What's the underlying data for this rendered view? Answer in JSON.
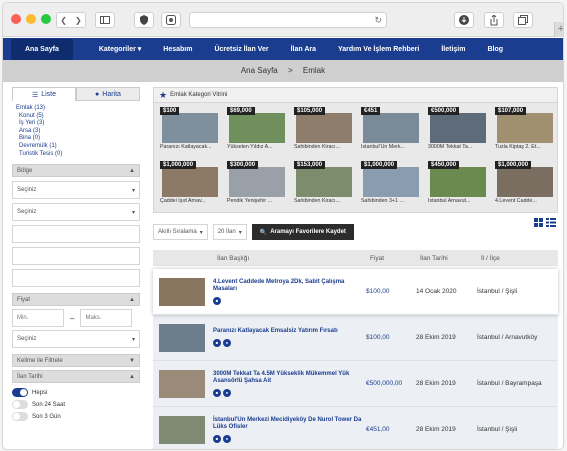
{
  "nav": {
    "items": [
      "Ana Sayfa",
      "Kategoriler",
      "Hesabım",
      "Ücretsiz İlan Ver",
      "İlan Ara",
      "Yardım Ve İşlem Rehberi",
      "İletişim",
      "Blog"
    ]
  },
  "breadcrumb": {
    "home": "Ana Sayfa",
    "sep": ">",
    "current": "Emlak"
  },
  "sidebar": {
    "tabs": [
      "Liste",
      "Harita"
    ],
    "categories": [
      "Emlak (13)",
      "Konut (5)",
      "İş Yeri (3)",
      "Arsa (3)",
      "Bina (0)",
      "Devremülk (1)",
      "Turistik Tesis (0)"
    ],
    "bolge": "Bölge",
    "select1": "Seçiniz",
    "select2": "Seçiniz",
    "fiyat": "Fiyat",
    "min": "Min.",
    "dash": "–",
    "max": "Maks.",
    "select3": "Seçiniz",
    "kelime": "Kelime ile Filtrele",
    "ilan_tarihi": "İlan Tarihi",
    "opt1": "Hepsi",
    "opt2": "Son 24 Saat",
    "opt3": "Son 3 Gün"
  },
  "vitrin": {
    "title": "Emlak Kategori Vitrini",
    "items": [
      {
        "price": "$100",
        "label": "Paranızı Katlayacak..."
      },
      {
        "price": "$69,000",
        "label": "Yükselen Yıldız A..."
      },
      {
        "price": "$105,000",
        "label": "Sahibinden Kiracı..."
      },
      {
        "price": "€451",
        "label": "İstanbul'Un Merk..."
      },
      {
        "price": "€500,000",
        "label": "3000M Tekkat Ta..."
      },
      {
        "price": "$107,000",
        "label": "Tuzla Kiptaş 2. Et..."
      },
      {
        "price": "$1,000,000",
        "label": "Çaddei Işıd Arnav..."
      },
      {
        "price": "$300,000",
        "label": "Pendik Yenişehir ..."
      },
      {
        "price": "$153,000",
        "label": "Sahibinden Kiracı..."
      },
      {
        "price": "$1,000,000",
        "label": "Sahibinden 3+1 ..."
      },
      {
        "price": "$450,000",
        "label": "İstanbul Arnavut..."
      },
      {
        "price": "$1,000,000",
        "label": "4.Levent Cadde..."
      }
    ]
  },
  "controls": {
    "sort": "Akıllı Sıralama",
    "count": "20 İlan",
    "fav": "Aramayı Favorilere Kaydet"
  },
  "table": {
    "headers": [
      "İlan Başlığı",
      "Fiyat",
      "İlan Tarihi",
      "İl / İlçe"
    ],
    "rows": [
      {
        "title": "4.Levent Caddede Metroya 2Dk, Sabit Çalışma Masaları",
        "price": "$100,00",
        "date": "14 Ocak 2020",
        "loc": "İstanbul / Şişli"
      },
      {
        "title": "Paranızı Katlayacak Emsalsiz Yatırım Fırsatı",
        "price": "$100,00",
        "date": "28 Ekim 2019",
        "loc": "İstanbul / Arnavutköy"
      },
      {
        "title": "3000M Tekkat Ta 4.5M Yükseklik Mükemmel Yük Asansörlü Şahsa Ait",
        "price": "€500,000,00",
        "date": "28 Ekim 2019",
        "loc": "İstanbul / Bayrampaşa"
      },
      {
        "title": "İstanbul'Un Merkezi Mecidiyeköy De Nurol Tower Da Lüks Ofisler",
        "price": "€451,00",
        "date": "28 Ekim 2019",
        "loc": "İstanbul / Şişli"
      }
    ]
  }
}
